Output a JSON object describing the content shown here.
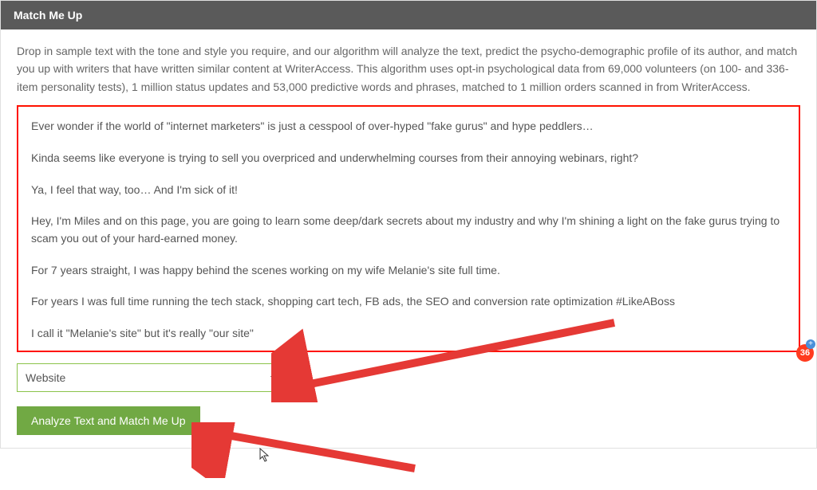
{
  "header": {
    "title": "Match Me Up"
  },
  "description": "Drop in sample text with the tone and style you require, and our algorithm will analyze the text, predict the psycho-demographic profile of its author, and match you up with writers that have written similar content at WriterAccess. This algorithm uses opt-in psychological data from 69,000 volunteers (on 100- and 336-item personality tests), 1 million status updates and 53,000 predictive words and phrases, matched to 1 million orders scanned in from WriterAccess.",
  "sample_text": {
    "p1": "Ever wonder if the world of \"internet marketers\" is just a cesspool of over-hyped \"fake gurus\" and hype peddlers…",
    "p2": "Kinda seems like everyone is trying to sell you overpriced and underwhelming courses from their annoying webinars, right?",
    "p3": "Ya, I feel that way, too… And I'm sick of it!",
    "p4": "Hey, I'm Miles and on this page, you are going to learn some deep/dark secrets about my industry and why I'm shining a light on the fake gurus trying to scam you out of your hard-earned money.",
    "p5": "For 7 years straight, I was happy behind the scenes working on my wife Melanie's site full time.",
    "p6": "For years I was full time running the tech stack, shopping cart tech, FB ads, the SEO and conversion rate optimization #LikeABoss",
    "p7": "I call it \"Melanie's site\" but it's really \"our site\""
  },
  "select": {
    "value": "Website"
  },
  "button": {
    "label": "Analyze Text and Match Me Up"
  },
  "badge": {
    "count": "36"
  }
}
